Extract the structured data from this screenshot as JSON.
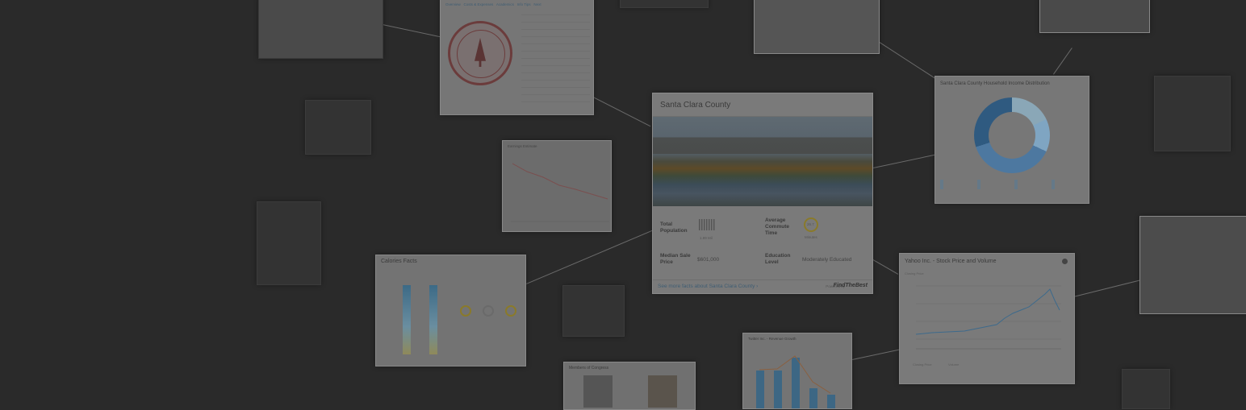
{
  "main_card": {
    "title": "Santa Clara County",
    "stats": [
      {
        "label": "Total Population",
        "sub": "1.89 Mil"
      },
      {
        "label": "Average Commute Time",
        "value": "26.7",
        "sub": "Minutes"
      },
      {
        "label": "Median Sale Price",
        "value": "$601,000"
      },
      {
        "label": "Education Level",
        "value": "Moderately Educated"
      }
    ],
    "link": "See more facts about Santa Clara County ›",
    "powered_by": "Powered by",
    "brand": "FindTheBest"
  },
  "cards": {
    "income": {
      "title": "Santa Clara County Household Income Distribution"
    },
    "yahoo": {
      "title": "Yahoo Inc. - Stock Price and Volume",
      "y_label": "Closing Price",
      "legend": [
        "Closing Price",
        "Volume"
      ]
    },
    "stanford": {
      "tabs": [
        "Overview",
        "Costs & Expenses",
        "Academics",
        "Info Tips",
        "Next"
      ]
    },
    "calories": {
      "title": "Calories Facts"
    },
    "senators": {
      "title": "Members of Congress"
    },
    "twitter": {
      "title": "Twitter Inc. - Revenue Growth"
    },
    "line_small": {
      "title": "Earnings Estimate"
    }
  },
  "colors": {
    "background": "#2a2a2a",
    "card": "#7c7c7c",
    "brand_blue": "#3f5d73",
    "donut_dark": "#2f5a80",
    "donut_mid": "#4d78a0",
    "donut_light": "#7fa5c2"
  }
}
